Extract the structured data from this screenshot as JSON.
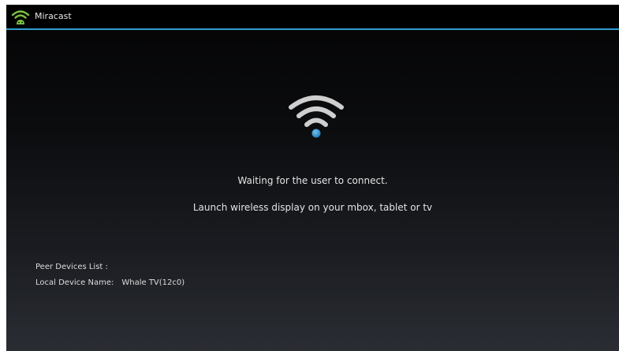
{
  "app": {
    "title": "Miracast",
    "icon": "android-wifi-icon",
    "accent_color": "#2f9fd0"
  },
  "main": {
    "status_icon": "wifi-signal-icon",
    "waiting_message": "Waiting for the user to connect.",
    "instruction_message": "Launch wireless display on your mbox, tablet or tv"
  },
  "info": {
    "peer_devices_label": "Peer Devices List :",
    "local_device_label": "Local Device Name:",
    "local_device_value": "Whale TV(12c0)"
  }
}
